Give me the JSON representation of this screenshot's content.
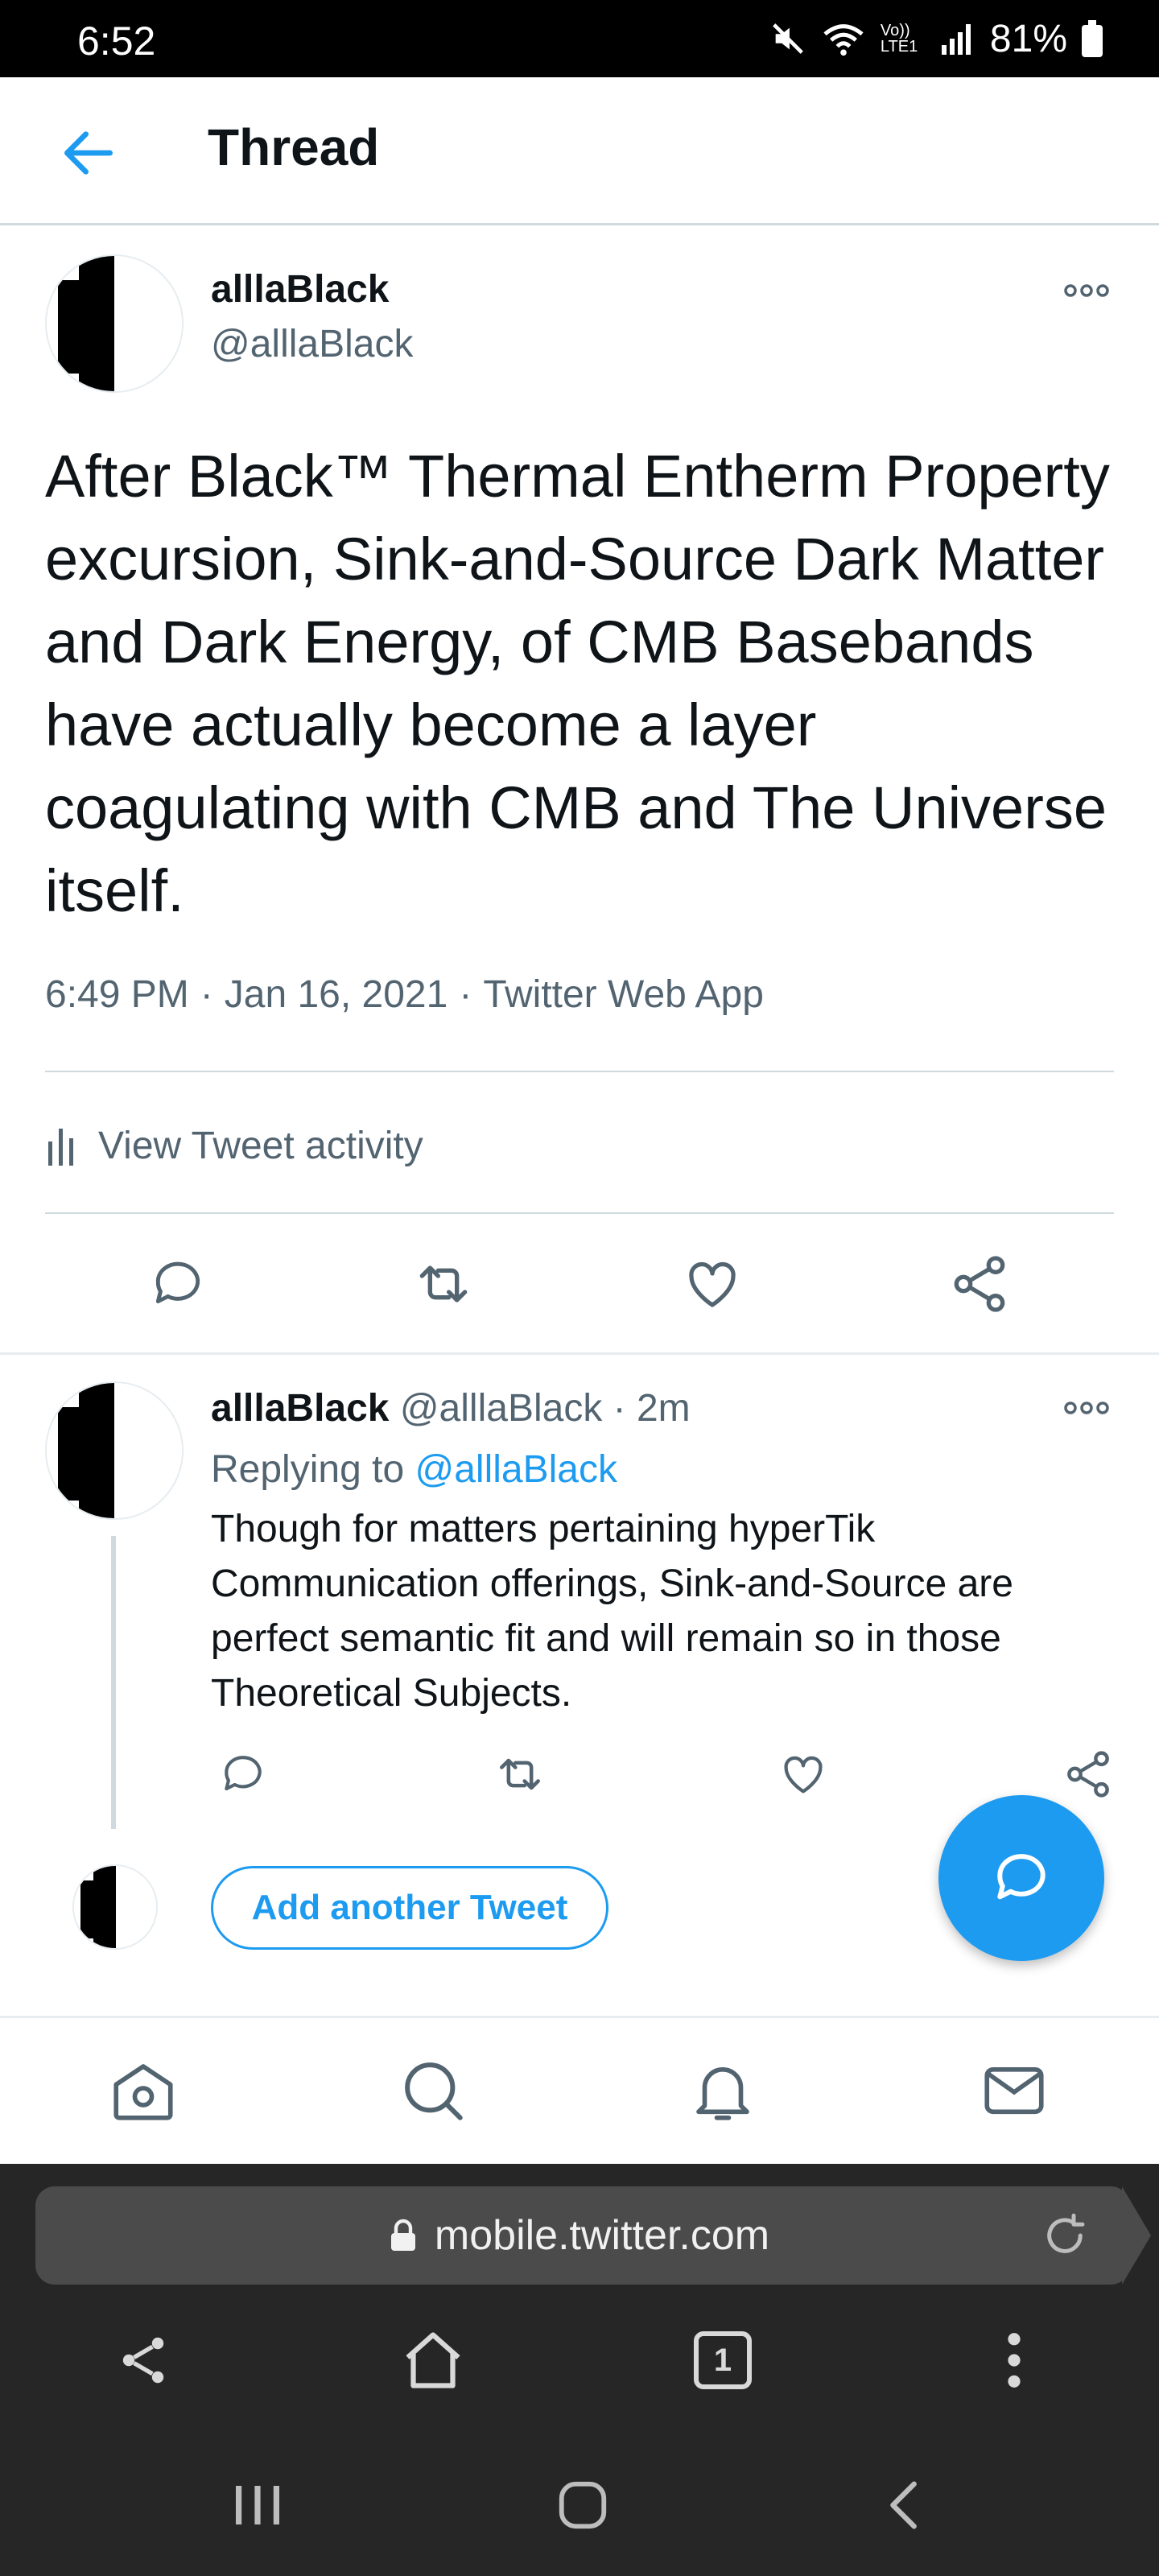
{
  "status_bar": {
    "time": "6:52",
    "battery": "81%",
    "network_label": "Vo)) LTE1"
  },
  "header": {
    "title": "Thread"
  },
  "main_tweet": {
    "display_name": "alllaBlack",
    "handle": "@alllaBlack",
    "text": "After Black™ Thermal Entherm Property excursion, Sink-and-Source Dark Matter and Dark Energy, of CMB Basebands have actually become a layer coagulating with CMB and The Universe itself.",
    "time": "6:49 PM",
    "date": "Jan 16, 2021",
    "source": "Twitter Web App",
    "activity_label": "View Tweet activity"
  },
  "reply_tweet": {
    "display_name": "alllaBlack",
    "handle": "@alllaBlack",
    "time_ago": "2m",
    "replying_prefix": "Replying to",
    "replying_handle": "@alllaBlack",
    "text": "Though for matters pertaining hyperTik Communication offerings, Sink-and-Source are perfect semantic fit and will remain so in those Theoretical Subjects."
  },
  "composer": {
    "add_label": "Add another Tweet"
  },
  "bottom_nav": {
    "items": [
      "home-icon",
      "search-icon",
      "notifications-icon",
      "messages-icon"
    ]
  },
  "browser": {
    "url": "mobile.twitter.com",
    "tab_count": "1"
  },
  "colors": {
    "accent": "#1d9bf0",
    "secondary_text": "#536471",
    "browser_bg": "#262626"
  }
}
